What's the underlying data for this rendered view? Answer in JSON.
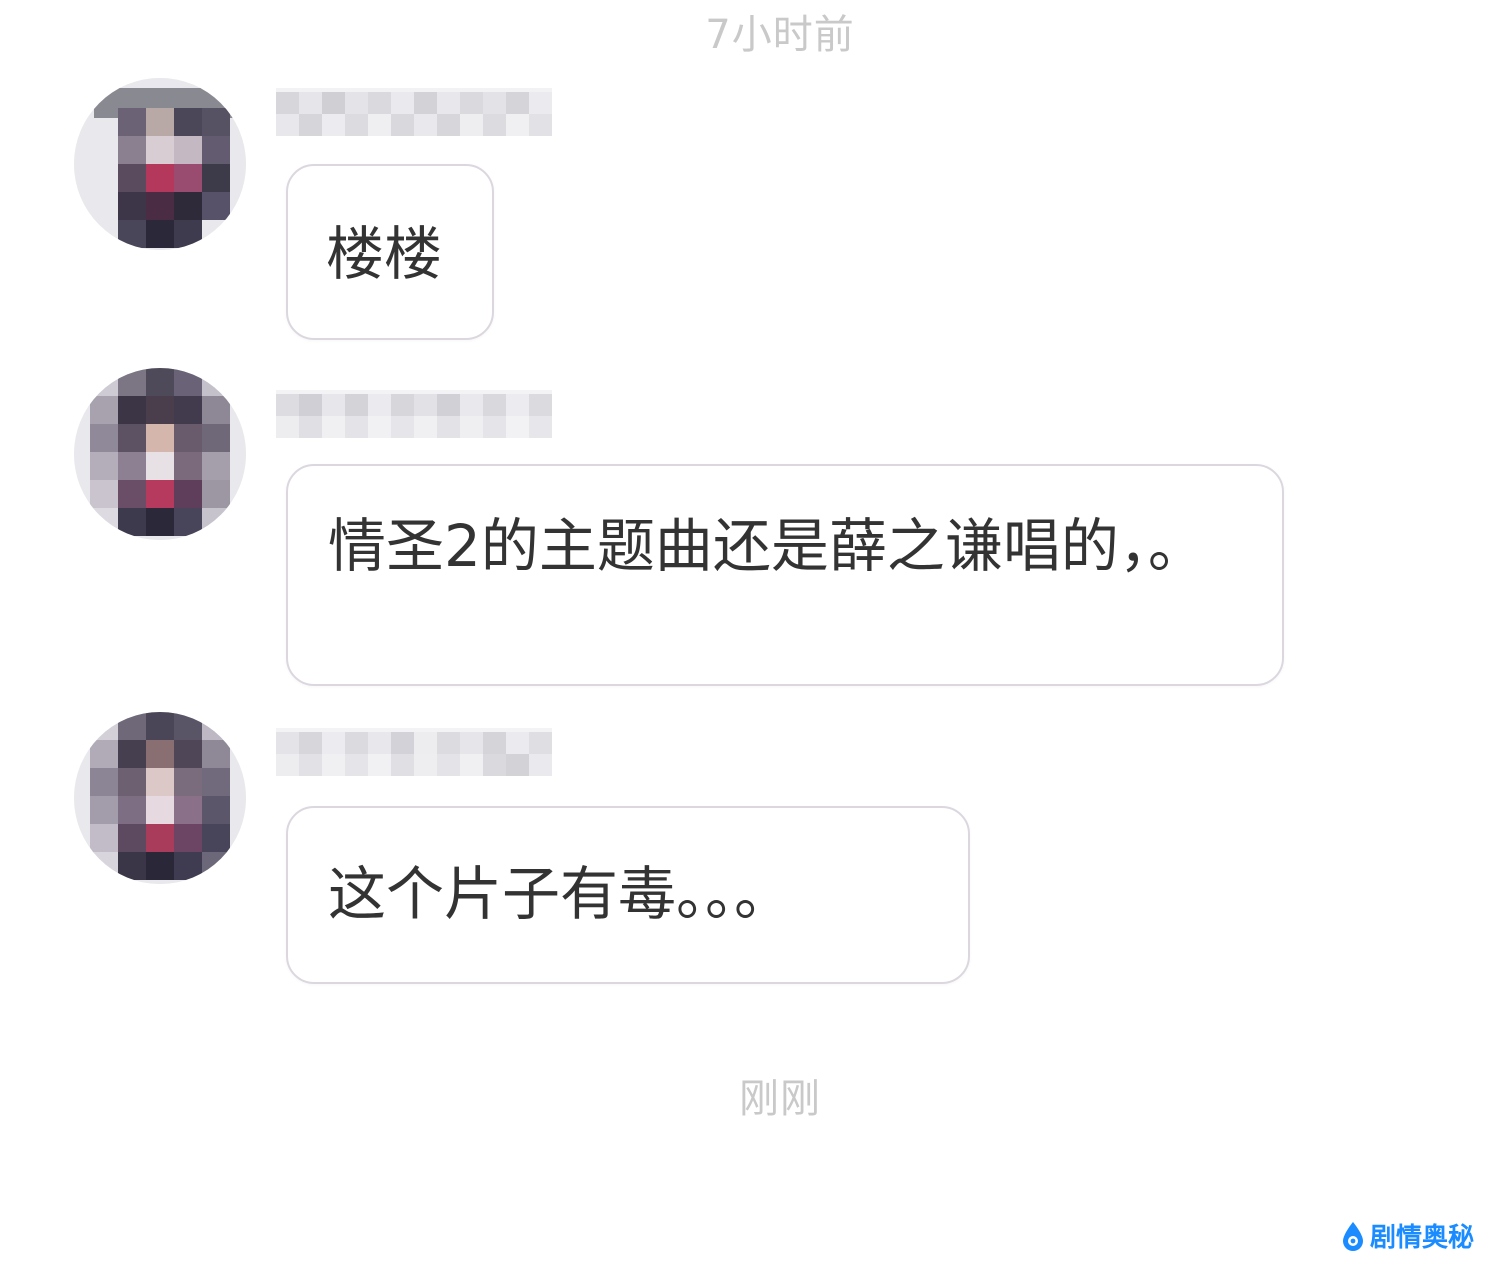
{
  "timestamps": {
    "top": "7小时前",
    "bottom": "刚刚"
  },
  "messages": [
    {
      "text": "楼楼"
    },
    {
      "text": "情圣2的主题曲还是薛之谦唱的，。"
    },
    {
      "text": "这个片子有毒。。。"
    }
  ],
  "watermark": {
    "logo_text": "剧情奥秘",
    "icon": "drop-logo-icon"
  },
  "colors": {
    "timestamp": "#c9c9c9",
    "bubble_border": "#dcd7df",
    "message_text": "#333333",
    "watermark": "#1a8cff"
  }
}
